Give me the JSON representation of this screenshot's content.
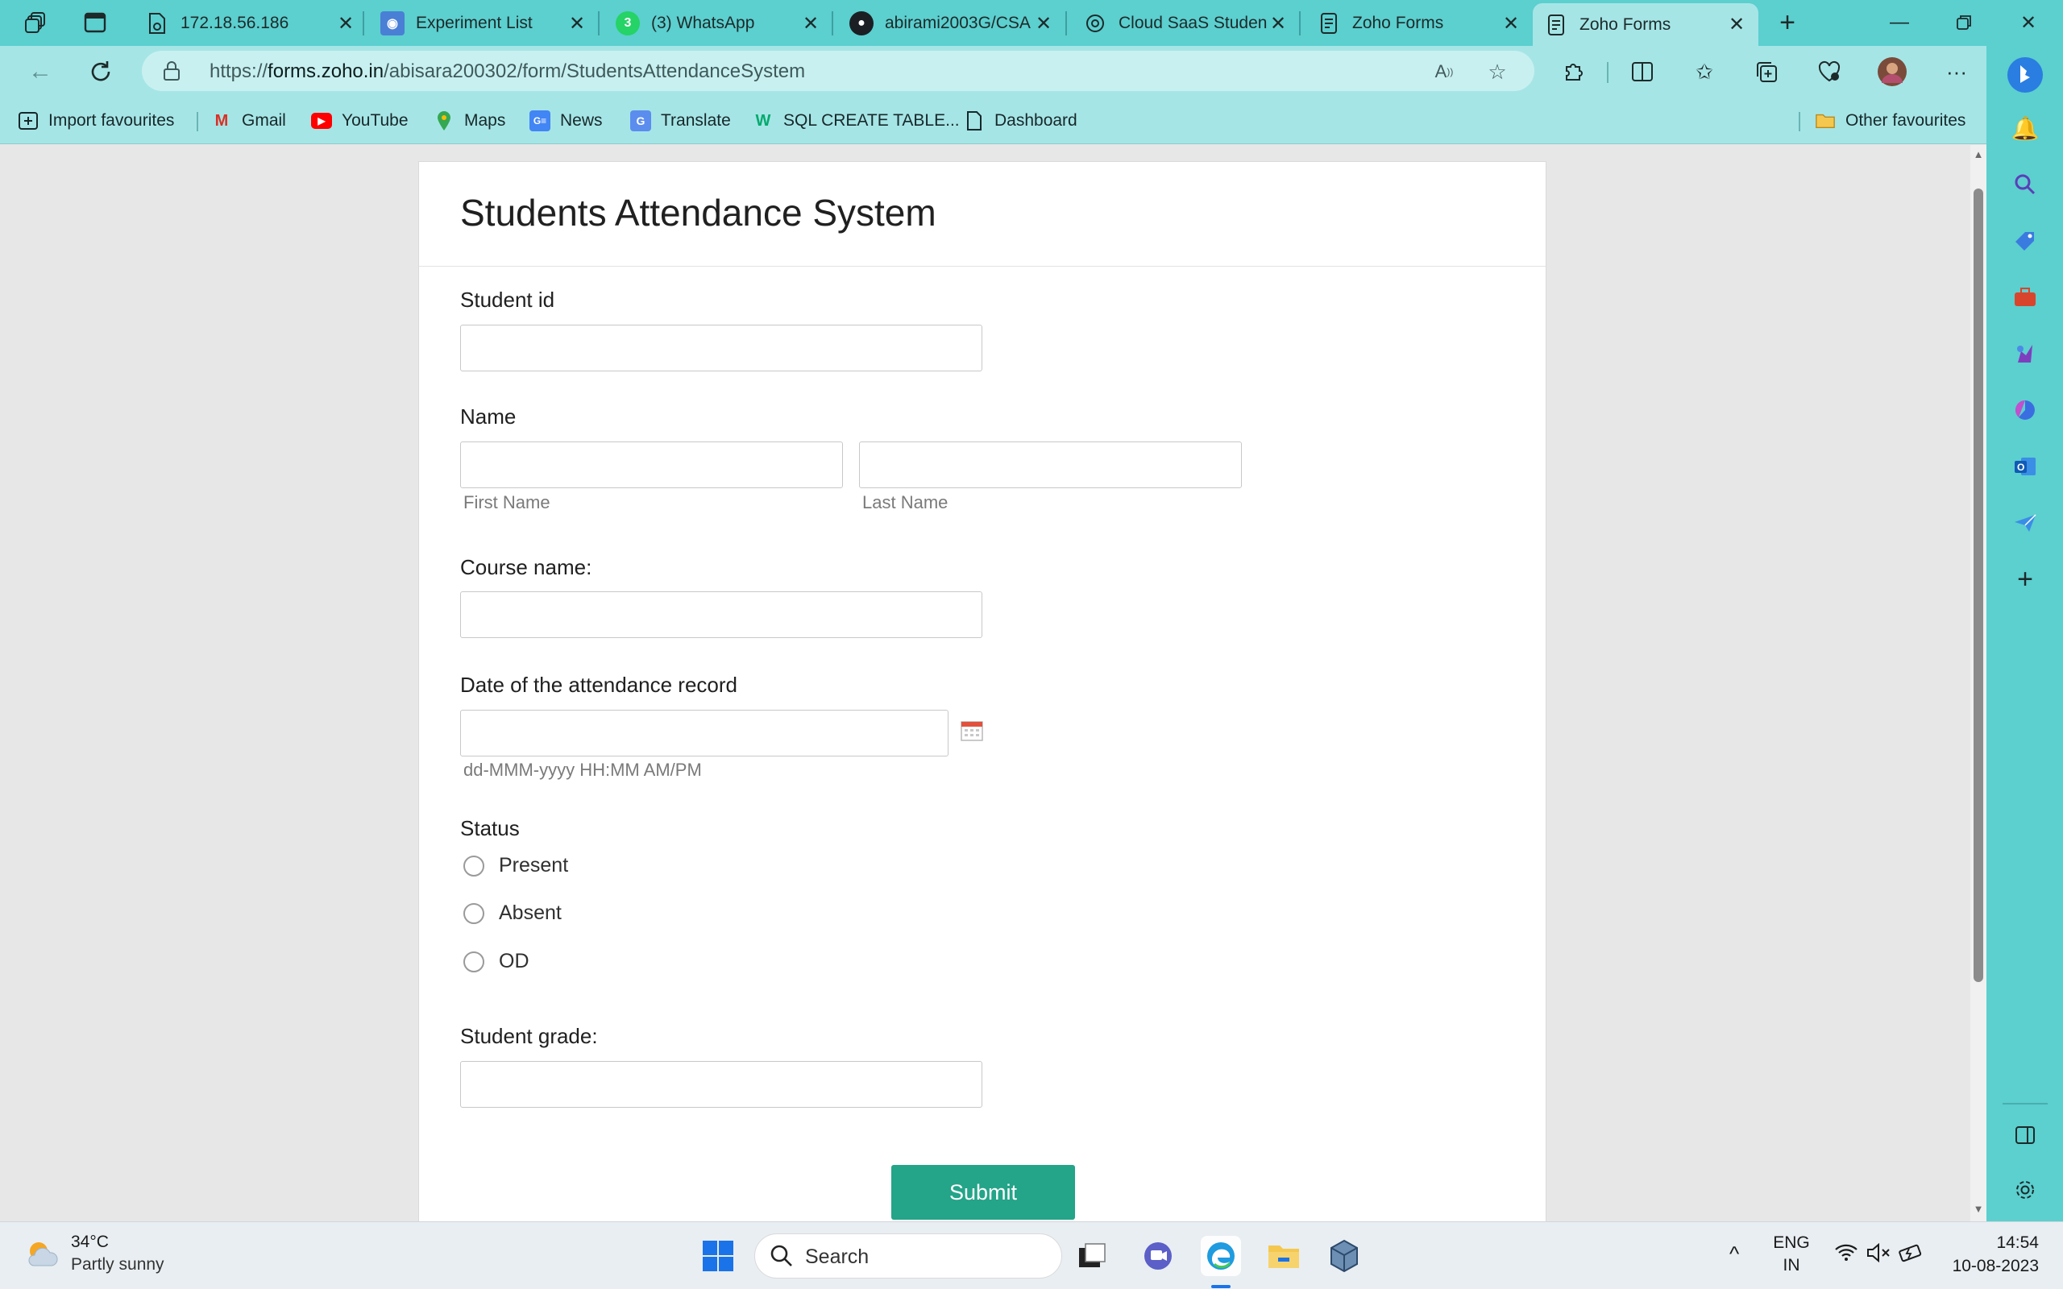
{
  "browser": {
    "tabs": [
      {
        "title": "172.18.56.186",
        "active": false
      },
      {
        "title": "Experiment List",
        "active": false
      },
      {
        "title": "(3) WhatsApp",
        "active": false
      },
      {
        "title": "abirami2003G/CSA",
        "active": false
      },
      {
        "title": "Cloud SaaS Studen",
        "active": false
      },
      {
        "title": "Zoho Forms",
        "active": false
      },
      {
        "title": "Zoho Forms",
        "active": true
      }
    ],
    "url_prefix": "https://",
    "url_host": "forms.zoho.in",
    "url_path": "/abisara200302/form/StudentsAttendanceSystem",
    "favourites": [
      {
        "label": "Import favourites",
        "icon": "import-icon"
      },
      {
        "label": "Gmail",
        "icon": "gmail-icon"
      },
      {
        "label": "YouTube",
        "icon": "youtube-icon"
      },
      {
        "label": "Maps",
        "icon": "maps-icon"
      },
      {
        "label": "News",
        "icon": "news-icon"
      },
      {
        "label": "Translate",
        "icon": "translate-icon"
      },
      {
        "label": "SQL CREATE TABLE...",
        "icon": "w3schools-icon"
      },
      {
        "label": "Dashboard",
        "icon": "document-icon"
      }
    ],
    "other_favourites": "Other favourites"
  },
  "form": {
    "title": "Students Attendance System",
    "student_id_label": "Student id",
    "name_label": "Name",
    "first_name_hint": "First Name",
    "last_name_hint": "Last Name",
    "course_label": "Course name:",
    "date_label": "Date of the attendance record",
    "date_hint": "dd-MMM-yyyy HH:MM AM/PM",
    "status_label": "Status",
    "status_options": [
      "Present",
      "Absent",
      "OD"
    ],
    "grade_label": "Student grade:",
    "submit_label": "Submit"
  },
  "taskbar": {
    "weather_temp": "34°C",
    "weather_desc": "Partly sunny",
    "search_placeholder": "Search",
    "lang_line1": "ENG",
    "lang_line2": "IN",
    "time": "14:54",
    "date": "10-08-2023"
  },
  "colors": {
    "chrome": "#5ccfcf",
    "chrome_light": "#a6e5e6",
    "submit": "#24a488"
  }
}
